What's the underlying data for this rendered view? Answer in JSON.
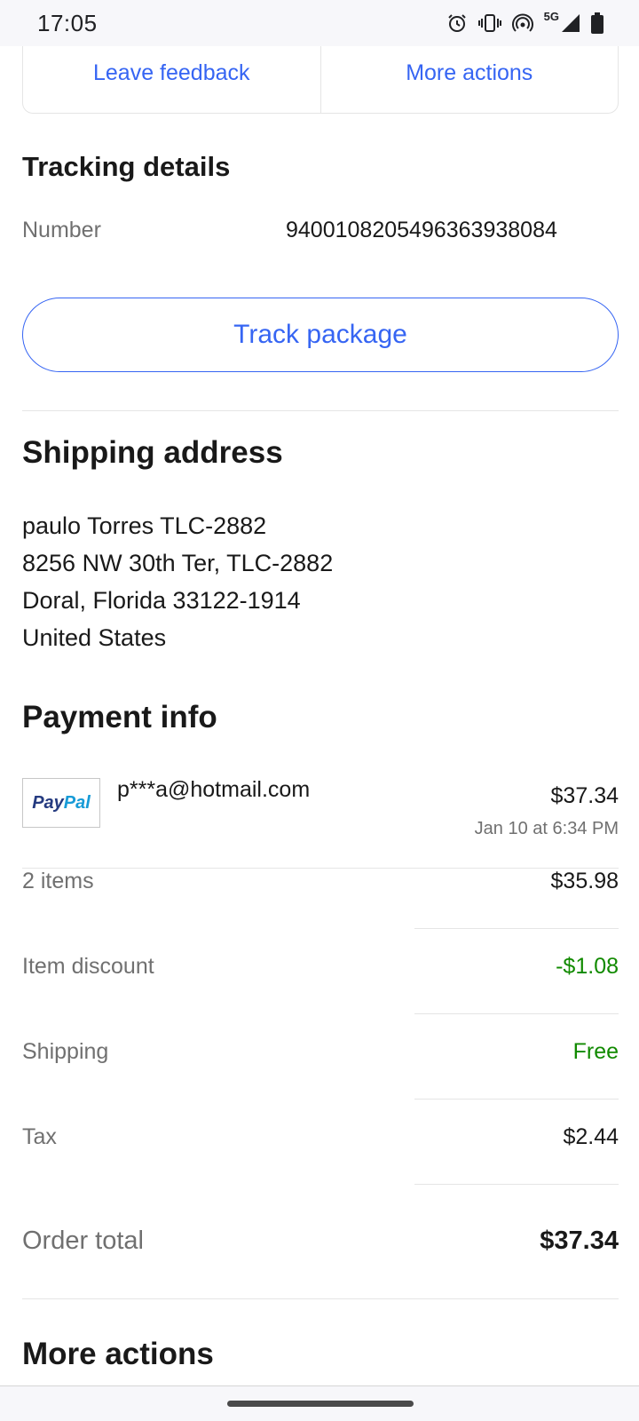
{
  "status_bar": {
    "time": "17:05",
    "network": "5G",
    "icons": [
      "alarm-icon",
      "vibrate-icon",
      "hotspot-icon",
      "signal-icon",
      "battery-icon"
    ]
  },
  "top_actions": {
    "leave_feedback": "Leave feedback",
    "more_actions": "More actions"
  },
  "tracking": {
    "title": "Tracking details",
    "number_label": "Number",
    "number_value": "9400108205496363938084",
    "track_button": "Track package"
  },
  "shipping_address": {
    "title": "Shipping address",
    "lines": [
      "paulo Torres TLC-2882",
      "8256 NW 30th Ter, TLC-2882",
      "Doral, Florida 33122-1914",
      "United States"
    ]
  },
  "payment": {
    "title": "Payment info",
    "method_logo": [
      "Pay",
      "Pal"
    ],
    "account": "p***a@hotmail.com",
    "amount": "$37.34",
    "date": "Jan 10 at 6:34 PM"
  },
  "summary": {
    "items_label": "2 items",
    "items_value": "$35.98",
    "discount_label": "Item discount",
    "discount_value": "-$1.08",
    "shipping_label": "Shipping",
    "shipping_value": "Free",
    "tax_label": "Tax",
    "tax_value": "$2.44",
    "total_label": "Order total",
    "total_value": "$37.34"
  },
  "more_actions_section": {
    "title": "More actions"
  },
  "colors": {
    "link_blue": "#3665f3",
    "positive_green": "#118a00",
    "muted_gray": "#707070"
  }
}
